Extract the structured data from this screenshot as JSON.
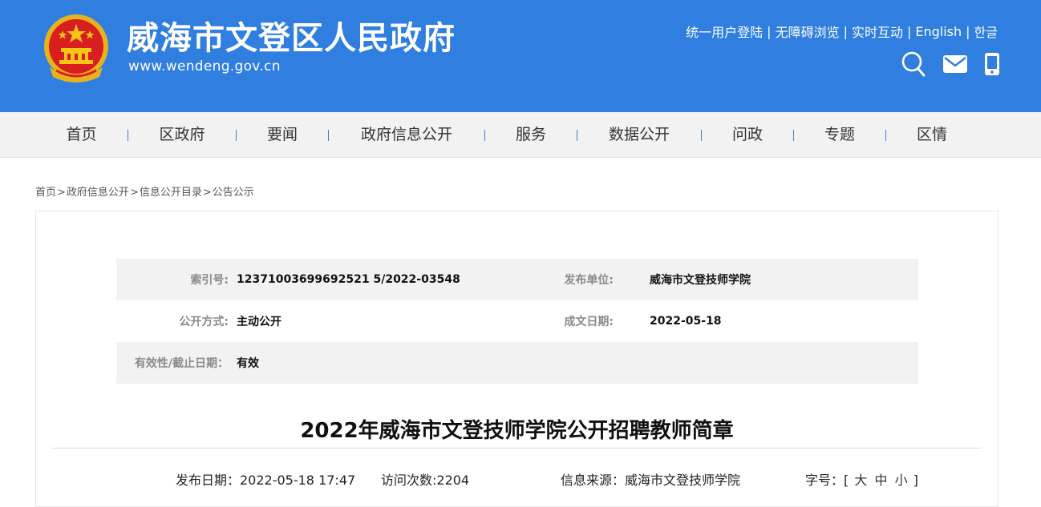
{
  "header": {
    "site_title": "威海市文登区人民政府",
    "site_domain": "www.wendeng.gov.cn",
    "top_links": [
      "统一用户登陆",
      "无障碍浏览",
      "实时互动",
      "English",
      "한글"
    ],
    "separator": "|",
    "icons": [
      "search-icon",
      "mail-icon",
      "mobile-icon"
    ],
    "brand_color": "#2f7ee0"
  },
  "nav": {
    "items": [
      "首页",
      "区政府",
      "要闻",
      "政府信息公开",
      "服务",
      "数据公开",
      "问政",
      "专题",
      "区情"
    ]
  },
  "breadcrumb": {
    "items": [
      "首页",
      "政府信息公开",
      "信息公开目录",
      "公告公示"
    ],
    "separator": ">"
  },
  "meta": {
    "rows": [
      {
        "label1": "索引号:",
        "value1": "12371003699692521 5/2022-03548",
        "label2": "发布单位:",
        "value2": "威海市文登技师学院"
      },
      {
        "label1": "公开方式:",
        "value1": "主动公开",
        "label2": "成文日期:",
        "value2": "2022-05-18"
      },
      {
        "label1": "有效性/截止日期：",
        "value1": "有效",
        "label2": "",
        "value2": ""
      }
    ]
  },
  "article": {
    "title": "2022年威海市文登技师学院公开招聘教师简章",
    "publish_date": "发布日期：2022-05-18 17:47",
    "visits": "访问次数:2204",
    "source": "信息来源：威海市文登技师学院",
    "font_size_label": "字号：[",
    "font_size_options": [
      "大",
      "中",
      "小"
    ],
    "font_size_end": "]"
  }
}
